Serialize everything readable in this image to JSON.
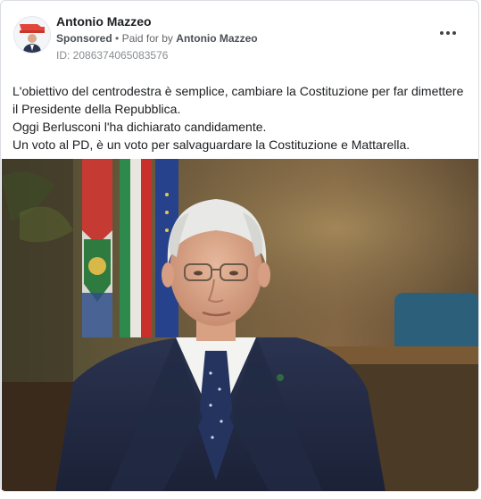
{
  "post": {
    "advertiser_name": "Antonio Mazzeo",
    "sponsored_label": "Sponsored",
    "separator": "•",
    "paid_for_prefix": "Paid for by",
    "paid_for_name": "Antonio Mazzeo",
    "ad_id": "ID: 2086374065083576",
    "more_icon": "more-horizontal-icon",
    "text_lines": [
      "L'obiettivo del centrodestra è semplice, cambiare la Costituzione per far dimettere",
      "il Presidente della Repubblica.",
      "Oggi Berlusconi l'ha dichiarato candidamente.",
      "Un voto al PD, è un voto per salvaguardare la Costituzione e Mattarella."
    ]
  },
  "colors": {
    "meta_text": "#65676b",
    "border": "#dadde1"
  }
}
